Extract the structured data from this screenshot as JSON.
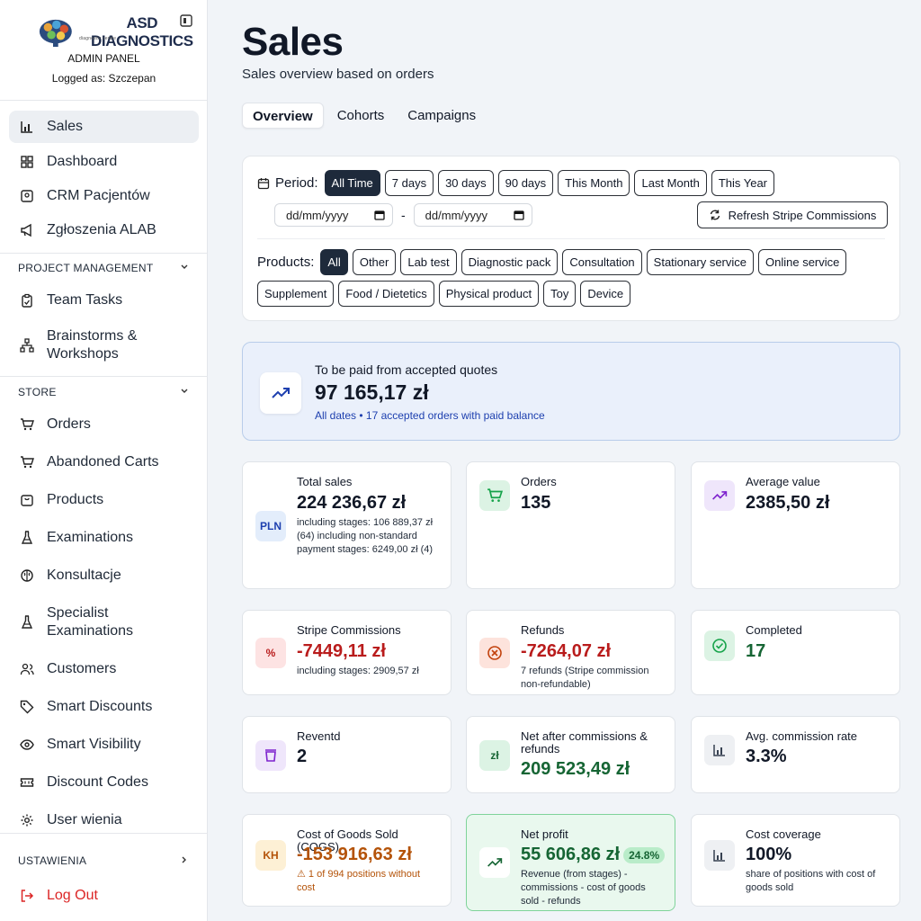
{
  "brand": {
    "logo_text": "ASD DIAGNOSTICS",
    "logo_subtitle": "diagnostic centre",
    "admin_label": "ADMIN PANEL",
    "logged_as": "Logged as: Szczepan"
  },
  "sidebar": {
    "items": [
      {
        "label": "Sales",
        "icon": "bar-chart-icon"
      },
      {
        "label": "Dashboard",
        "icon": "grid-icon"
      },
      {
        "label": "CRM Pacjentów",
        "icon": "contact-icon"
      },
      {
        "label": "Zgłoszenia ALAB",
        "icon": "megaphone-icon"
      }
    ],
    "section_pm": "PROJECT MANAGEMENT",
    "pm_items": [
      {
        "label": "Team Tasks",
        "icon": "clipboard-icon"
      },
      {
        "label": "Brainstorms &",
        "label2": "Workshops",
        "icon": "network-icon"
      }
    ],
    "section_store": "STORE",
    "store_items": [
      {
        "label": "Orders",
        "icon": "cart-icon"
      },
      {
        "label": "Abandoned Carts",
        "icon": "cart-icon"
      },
      {
        "label": "Products",
        "icon": "package-icon"
      },
      {
        "label": "Examinations",
        "icon": "flask-icon"
      },
      {
        "label": "Konsultacje",
        "icon": "brain-icon"
      },
      {
        "label": "Specialist",
        "label2": "Examinations",
        "icon": "flask-icon"
      },
      {
        "label": "Customers",
        "icon": "users-icon"
      },
      {
        "label": "Smart Discounts",
        "icon": "tag-icon"
      },
      {
        "label": "Smart Visibility",
        "icon": "eye-icon"
      },
      {
        "label": "Discount Codes",
        "icon": "ticket-icon"
      },
      {
        "label": "User wienia",
        "icon": "gear-icon"
      }
    ],
    "settings": "USTAWIENIA",
    "logout": "Log Out"
  },
  "header": {
    "title": "Sales",
    "subtitle": "Sales overview based on orders",
    "tabs": [
      "Overview",
      "Cohorts",
      "Campaigns"
    ]
  },
  "filters": {
    "period_label": "Period:",
    "periods": [
      "All Time",
      "7 days",
      "30 days",
      "90 days",
      "This Month",
      "Last Month",
      "This Year"
    ],
    "date_from": "dd/mm/yyyy",
    "date_to": "dd/mm/yyyy",
    "date_sep": "-",
    "refresh": "Refresh Stripe Commissions",
    "products_label": "Products:",
    "products_row1": [
      "All",
      "Other",
      "Lab test",
      "Diagnostic pack",
      "Consultation",
      "Stationary service",
      "Online service"
    ],
    "products_row2": [
      "Supplement",
      "Food / Dietetics",
      "Physical product",
      "Toy",
      "Device"
    ]
  },
  "quotes": {
    "title": "To be paid from accepted quotes",
    "value": "97 165,17 zł",
    "sub": "All dates • 17 accepted orders with paid balance"
  },
  "stats": {
    "total_sales": {
      "icon_text": "PLN",
      "title": "Total sales",
      "value": "224 236,67 zł",
      "note": "including stages: 106 889,37 zł (64) including non-standard payment stages: 6249,00 zł (4)"
    },
    "orders": {
      "title": "Orders",
      "value": "135"
    },
    "avg_value": {
      "title": "Average value",
      "value": "2385,50 zł"
    },
    "stripe": {
      "icon_text": "%",
      "title": "Stripe Commissions",
      "value": "-7449,11 zł",
      "note": "including stages: 2909,57 zł"
    },
    "refunds": {
      "title": "Refunds",
      "value": "-7264,07 zł",
      "note": "7 refunds (Stripe commission non-refundable)"
    },
    "completed": {
      "title": "Completed",
      "value": "17"
    },
    "revented": {
      "title": "Reventd",
      "value": "2"
    },
    "net_after": {
      "icon_text": "zł",
      "title": "Net after commissions & refunds",
      "value": "209 523,49 zł"
    },
    "avg_commission": {
      "title": "Avg. commission rate",
      "value": "3.3%"
    },
    "cogs": {
      "icon_text": "KH",
      "title": "Cost of Goods Sold (COGS)",
      "value": "-153 916,63 zł",
      "note": "⚠ 1 of 994 positions without cost"
    },
    "net_profit": {
      "title": "Net profit",
      "value": "55 606,86 zł",
      "badge": "24.8%",
      "note": "Revenue (from stages) - commissions - cost of goods sold - refunds"
    },
    "coverage": {
      "title": "Cost coverage",
      "value": "100%",
      "note": "share of positions with cost of goods sold"
    }
  },
  "colors": {
    "accent_dark": "#1e2a3b",
    "negative": "#b91c1c",
    "positive": "#166534",
    "info_bg": "#eaf0fb"
  }
}
